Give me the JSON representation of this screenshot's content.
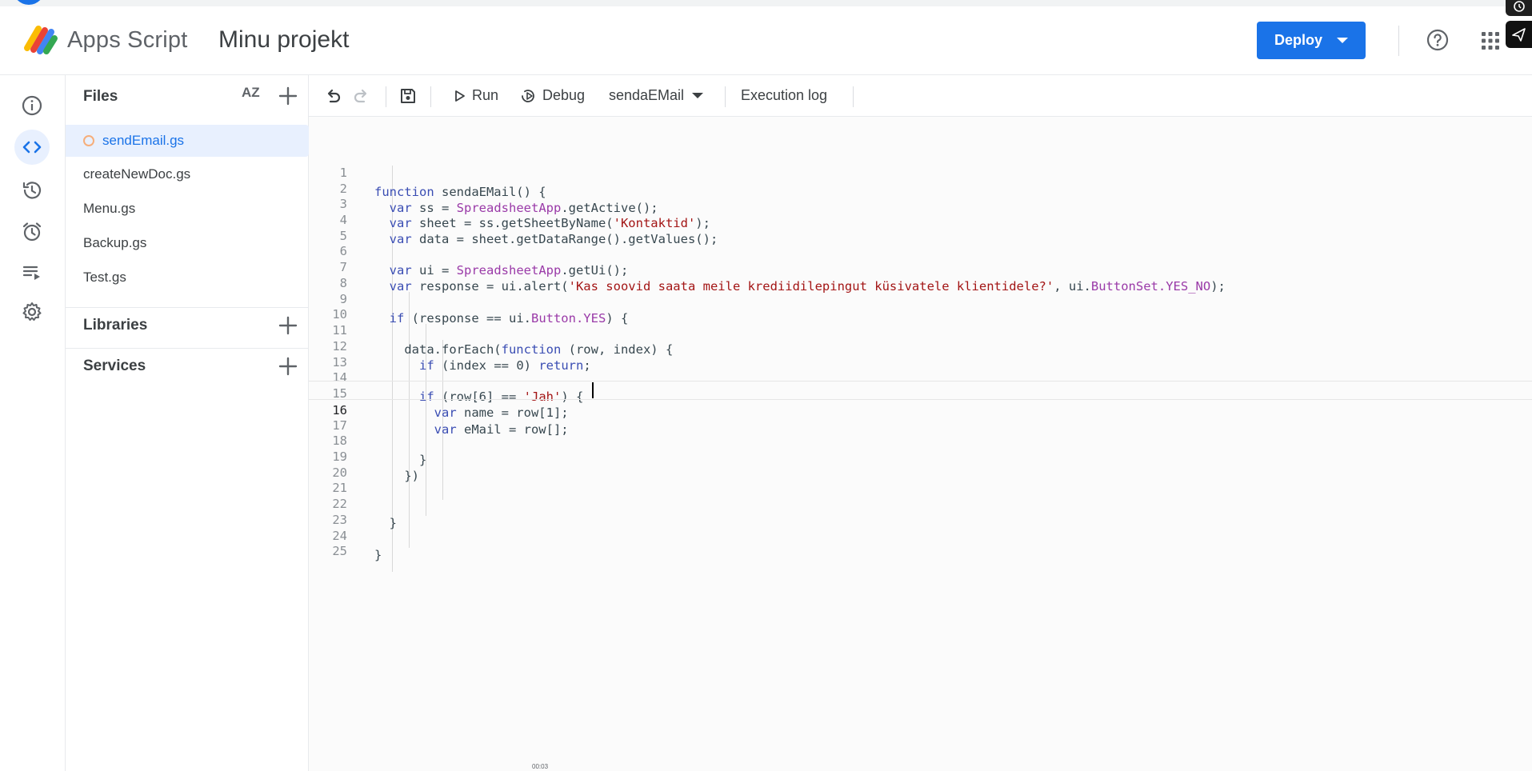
{
  "header": {
    "app_name": "Apps Script",
    "project_name": "Minu projekt",
    "deploy_label": "Deploy"
  },
  "rail": {
    "items": [
      {
        "name": "overview",
        "icon": "info-icon"
      },
      {
        "name": "editor",
        "icon": "code-icon",
        "active": true
      },
      {
        "name": "project-history",
        "icon": "history-icon"
      },
      {
        "name": "triggers",
        "icon": "alarm-icon"
      },
      {
        "name": "executions",
        "icon": "executions-icon"
      },
      {
        "name": "project-settings",
        "icon": "gear-icon"
      }
    ]
  },
  "files_panel": {
    "title": "Files",
    "sort_label": "AZ",
    "files": [
      {
        "name": "sendEmail.gs",
        "active": true,
        "unsaved": true
      },
      {
        "name": "createNewDoc.gs"
      },
      {
        "name": "Menu.gs"
      },
      {
        "name": "Backup.gs"
      },
      {
        "name": "Test.gs"
      }
    ],
    "libraries_label": "Libraries",
    "services_label": "Services"
  },
  "toolbar": {
    "run_label": "Run",
    "debug_label": "Debug",
    "function_selector": "sendaEMail",
    "execution_log_label": "Execution log"
  },
  "editor": {
    "current_line": 16,
    "lines": [
      "function sendaEMail() {",
      "  var ss = SpreadsheetApp.getActive();",
      "  var sheet = ss.getSheetByName('Kontaktid');",
      "  var data = sheet.getDataRange().getValues();",
      "",
      "  var ui = SpreadsheetApp.getUi();",
      "  var response = ui.alert('Kas soovid saata meile krediidilepingut küsivatele klientidele?', ui.ButtonSet.YES_NO);",
      "",
      "  if (response == ui.Button.YES) {",
      "",
      "    data.forEach(function (row, index) {",
      "      if (index == 0) return;",
      "",
      "      if (row[6] == 'Jah') {",
      "        var name = row[1];",
      "        var eMail = row[];",
      "",
      "      }",
      "    })",
      "",
      "",
      "  }",
      "",
      "}",
      ""
    ]
  },
  "video_timestamp": "00:03",
  "colors": {
    "accent": "#1a73e8",
    "active_bg": "#e8f0fe",
    "keyword": "#3a4db3",
    "string": "#a31515",
    "class": "#9a3aa8"
  }
}
